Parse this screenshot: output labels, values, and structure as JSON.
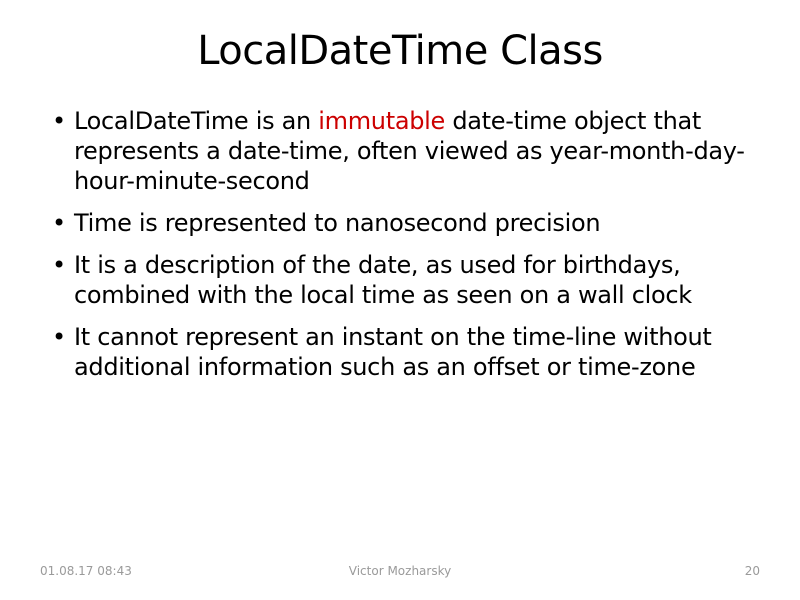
{
  "title": "LocalDateTime Class",
  "bullets": [
    {
      "pre": "LocalDateTime is an ",
      "highlight": "immutable",
      "post": " date-time object that represents a date-time, often viewed as year-month-day-hour-minute-second"
    },
    {
      "pre": "Time is represented to nanosecond precision",
      "highlight": "",
      "post": ""
    },
    {
      "pre": "It is a description of the date, as used for birthdays, combined with the local time as seen on a wall clock",
      "highlight": "",
      "post": ""
    },
    {
      "pre": "It cannot represent an instant on the time-line without additional information such as an offset or time-zone",
      "highlight": "",
      "post": ""
    }
  ],
  "footer": {
    "date": "01.08.17 08:43",
    "author": "Victor Mozharsky",
    "page": "20"
  }
}
